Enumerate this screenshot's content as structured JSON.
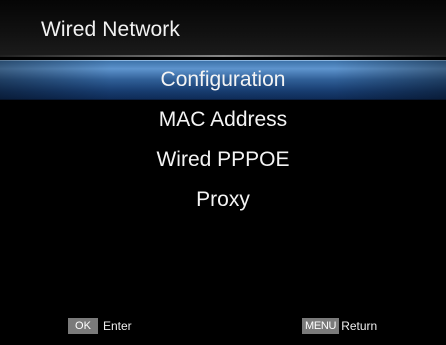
{
  "header": {
    "title": "Wired Network"
  },
  "menu": {
    "items": [
      {
        "label": "Configuration",
        "selected": true
      },
      {
        "label": "MAC Address",
        "selected": false
      },
      {
        "label": "Wired PPPOE",
        "selected": false
      },
      {
        "label": "Proxy",
        "selected": false
      }
    ]
  },
  "footer": {
    "ok_key": "OK",
    "ok_action": "Enter",
    "menu_key": "MENU",
    "menu_action": "Return"
  },
  "colors": {
    "background": "#000000",
    "highlight": "#2f5e96",
    "key_background": "#7a7a7a"
  }
}
